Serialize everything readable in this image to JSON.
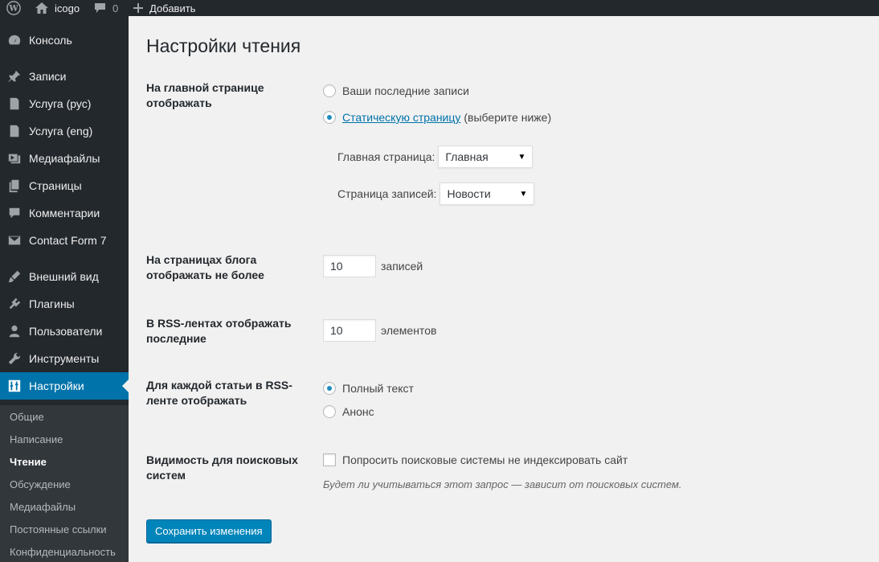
{
  "admin_bar": {
    "site_name": "icogo",
    "comments_count": "0",
    "new_label": "Добавить"
  },
  "sidebar": {
    "items": [
      {
        "label": "Консоль",
        "icon": "dashboard-icon"
      },
      {
        "label": "Записи",
        "icon": "pin-icon"
      },
      {
        "label": "Услуга (рус)",
        "icon": "document-icon"
      },
      {
        "label": "Услуга (eng)",
        "icon": "document-icon"
      },
      {
        "label": "Медиафайлы",
        "icon": "media-icon"
      },
      {
        "label": "Страницы",
        "icon": "pages-icon"
      },
      {
        "label": "Комментарии",
        "icon": "comment-icon"
      },
      {
        "label": "Contact Form 7",
        "icon": "mail-icon"
      },
      {
        "label": "Внешний вид",
        "icon": "brush-icon"
      },
      {
        "label": "Плагины",
        "icon": "plugin-icon"
      },
      {
        "label": "Пользователи",
        "icon": "user-icon"
      },
      {
        "label": "Инструменты",
        "icon": "wrench-icon"
      },
      {
        "label": "Настройки",
        "icon": "settings-icon"
      }
    ],
    "submenu": [
      "Общие",
      "Написание",
      "Чтение",
      "Обсуждение",
      "Медиафайлы",
      "Постоянные ссылки",
      "Конфиденциальность"
    ],
    "colors": {
      "background": "#23282d",
      "active": "#0073aa",
      "submenu_bg": "#32373c"
    }
  },
  "page": {
    "title": "Настройки чтения",
    "front_page": {
      "label": "На главной странице отображать",
      "option_latest": "Ваши последние записи",
      "option_static_link": "Статическую страницу",
      "option_static_suffix": "(выберите ниже)",
      "homepage_label": "Главная страница:",
      "homepage_value": "Главная",
      "posts_page_label": "Страница записей:",
      "posts_page_value": "Новости"
    },
    "posts_per_page": {
      "label": "На страницах блога отображать не более",
      "value": "10",
      "unit": "записей"
    },
    "rss_items": {
      "label": "В RSS-лентах отображать последние",
      "value": "10",
      "unit": "элементов"
    },
    "rss_content": {
      "label": "Для каждой статьи в RSS-ленте отображать",
      "option_full": "Полный текст",
      "option_summary": "Анонс"
    },
    "search_visibility": {
      "label": "Видимость для поисковых систем",
      "checkbox_label": "Попросить поисковые системы не индексировать сайт",
      "description": "Будет ли учитываться этот запрос — зависит от поисковых систем."
    },
    "save_label": "Сохранить изменения",
    "accent_color": "#0085ba"
  }
}
